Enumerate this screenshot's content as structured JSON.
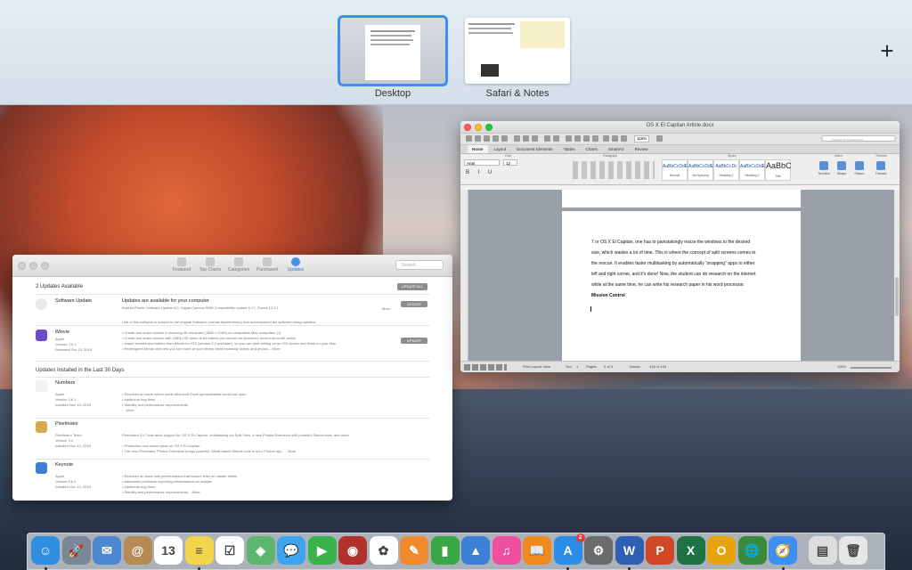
{
  "mission_control": {
    "spaces": [
      {
        "label": "Desktop"
      },
      {
        "label": "Safari & Notes"
      }
    ],
    "add_space": "+"
  },
  "appstore": {
    "search_placeholder": "Search",
    "tabs": [
      "Featured",
      "Top Charts",
      "Categories",
      "Purchased",
      "Updates"
    ],
    "updates_available_title": "2 Updates Available",
    "update_all_label": "UPDATE ALL",
    "software_update": {
      "name": "Software Update",
      "headline": "Updates are available for your computer",
      "desc": "Brother Printer Software Update 5.0, Digital Camera RAW Compatibility Update 6.17, iTunes 12.3.1",
      "more": "More",
      "button": "UPDATE",
      "license_note": "Use of this software is subject to the original Software License Agreement(s) that accompanied the software being updated."
    },
    "imovie": {
      "name": "iMovie",
      "publisher": "Apple",
      "version": "Version: 10.1",
      "released": "Released Oct 13, 2015",
      "desc": [
        "• Create and share movies in stunning 4K resolution (3840 x 2160) on compatible Mac computers (1)",
        "• Create and share movies with 1080p HD video at 60 frames per second for smoother, more true-to-life action",
        "• Import movies and trailers from iMovie for iOS (version 2.2 and later), so you can start editing on an iOS device and finish on your Mac",
        "• Redesigned Media view lets you see more of your library while browsing videos and photos... More"
      ],
      "button": "UPDATE"
    },
    "installed_title": "Updates Installed in the Last 30 Days",
    "installed": [
      {
        "name": "Numbers",
        "publisher": "Apple",
        "version": "Version 3.6.1",
        "installed": "Installed Nov 13, 2015",
        "desc": [
          "• Resolves an issue where some Microsoft Excel spreadsheets would not open",
          "• Additional bug fixes",
          "• Stability and performance improvements",
          "... More"
        ]
      },
      {
        "name": "Pixelmator",
        "publisher": "Pixelmator Team",
        "version": "Version 3.4",
        "installed": "Installed Nov 13, 2015",
        "desc": [
          "Pixelmator 3.4 Twist adds support for OS X El Capitan, multitasking via Split View, a new Photos Extension with powerful Distort tools, and more.",
          "",
          "• Pixelmator now works great on OS X El Capitan",
          "• The new Pixelmator Photos Extension brings powerful, Metal-based Distort tools to your Photos app. ... More"
        ]
      },
      {
        "name": "Keynote",
        "publisher": "Apple",
        "version": "Version 6.6.1",
        "installed": "Installed Nov 13, 2015",
        "desc": [
          "• Resolves an issue with presentations that feature links on master slides",
          "• Addresses problems exporting presentations as images",
          "• Additional bug fixes",
          "• Stability and performance improvements... More"
        ]
      }
    ]
  },
  "word": {
    "title": "OS X El Capitan Article.docx",
    "zoom": "116%",
    "search_placeholder": "Search in Document",
    "tabs": [
      "Home",
      "Layout",
      "Document Elements",
      "Tables",
      "Charts",
      "SmartArt",
      "Review"
    ],
    "font_name": "Arial",
    "font_size": "12",
    "groups": {
      "font": "Font",
      "paragraph": "Paragraph",
      "styles": "Styles",
      "insert": "Insert",
      "themes": "Themes"
    },
    "styles": [
      {
        "preview": "AaBbCcDdEe",
        "name": "Normal"
      },
      {
        "preview": "AaBbCcDdEe",
        "name": "No Spacing"
      },
      {
        "preview": "AaBbCcDc",
        "name": "Heading 1"
      },
      {
        "preview": "AaBbCcDdE",
        "name": "Heading 2"
      },
      {
        "preview": "AaBbC",
        "name": "Title"
      }
    ],
    "insert_items": [
      "Text Box",
      "Shape",
      "Picture",
      "Themes"
    ],
    "body_lines": [
      "7 or OS X El Capitan, one has to painstakingly resize the windows to the desired",
      "size, which wastes a lot of time. This is where the concept of split screens comes to",
      "the rescue. It enables faster multitasking by automatically “snapping” apps to either",
      "left and right corner, and it’s done! Now, the student can do research on the internet",
      "while at the same time, he can write his research paper in his word processor."
    ],
    "heading": "Mission Control",
    "status": {
      "view": "Print Layout View",
      "sec": "Sec",
      "sec_val": "1",
      "pages": "Pages:",
      "pages_val": "3 of 3",
      "words": "Words:",
      "words_val": "416 of 416",
      "zoom": "116%"
    }
  },
  "dock": {
    "items": [
      {
        "name": "Finder",
        "glyph": "☺",
        "color": "#2f8ee0",
        "running": true
      },
      {
        "name": "Launchpad",
        "glyph": "🚀",
        "color": "#7b8796",
        "running": false
      },
      {
        "name": "Mail",
        "glyph": "✉",
        "color": "#4c87d1",
        "running": false
      },
      {
        "name": "Contacts",
        "glyph": "@",
        "color": "#b48a55",
        "running": false
      },
      {
        "name": "Calendar",
        "glyph": "13",
        "color": "#ffffff",
        "running": false
      },
      {
        "name": "Notes",
        "glyph": "≡",
        "color": "#f3d54d",
        "running": true
      },
      {
        "name": "Reminders",
        "glyph": "☑",
        "color": "#ffffff",
        "running": false
      },
      {
        "name": "Maps",
        "glyph": "◈",
        "color": "#5eb56d",
        "running": false
      },
      {
        "name": "Messages",
        "glyph": "💬",
        "color": "#3ea4f0",
        "running": false
      },
      {
        "name": "FaceTime",
        "glyph": "▶",
        "color": "#3bb34a",
        "running": false
      },
      {
        "name": "Photo Booth",
        "glyph": "◉",
        "color": "#b0302c",
        "running": false
      },
      {
        "name": "Photos",
        "glyph": "✿",
        "color": "#ffffff",
        "running": false
      },
      {
        "name": "Pages",
        "glyph": "✎",
        "color": "#f08a2d",
        "running": false
      },
      {
        "name": "Numbers",
        "glyph": "▮",
        "color": "#38a846",
        "running": false
      },
      {
        "name": "Keynote",
        "glyph": "▲",
        "color": "#3c7fd6",
        "running": false
      },
      {
        "name": "iTunes",
        "glyph": "♫",
        "color": "#f04fa0",
        "running": false
      },
      {
        "name": "iBooks",
        "glyph": "📖",
        "color": "#f08a1d",
        "running": false
      },
      {
        "name": "App Store",
        "glyph": "A",
        "color": "#2b8de8",
        "running": true,
        "badge": "2"
      },
      {
        "name": "System Preferences",
        "glyph": "⚙",
        "color": "#6b6b6b",
        "running": false
      },
      {
        "name": "Microsoft Word",
        "glyph": "W",
        "color": "#2f5fb3",
        "running": true
      },
      {
        "name": "Microsoft PowerPoint",
        "glyph": "P",
        "color": "#d24726",
        "running": false
      },
      {
        "name": "Microsoft Excel",
        "glyph": "X",
        "color": "#207245",
        "running": false
      },
      {
        "name": "Microsoft Outlook",
        "glyph": "O",
        "color": "#e8a40c",
        "running": false
      },
      {
        "name": "Network Utility",
        "glyph": "🌐",
        "color": "#3a8a3a",
        "running": false
      },
      {
        "name": "Safari",
        "glyph": "🧭",
        "color": "#3d8ff0",
        "running": true
      },
      {
        "name": "Documents",
        "glyph": "▤",
        "color": "#dddddd",
        "running": false
      },
      {
        "name": "Trash",
        "glyph": "🗑",
        "color": "#e6e6e6",
        "running": false
      }
    ]
  }
}
